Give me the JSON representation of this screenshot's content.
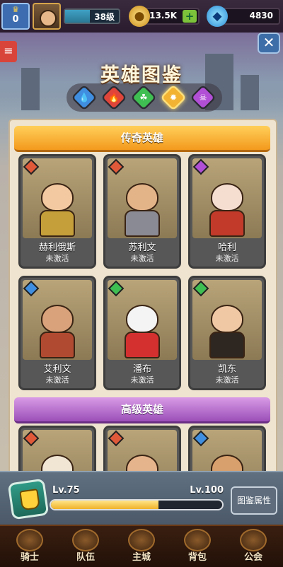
{
  "hud": {
    "rank_value": "0",
    "level_label": "38级",
    "coins": "13.5K",
    "gems": "4830",
    "plus_symbol": "+"
  },
  "panel": {
    "title": "英雄图鉴",
    "close_symbol": "✕",
    "filters": [
      {
        "icon": "water-element-icon",
        "symbol": "💧",
        "color": "#3f8ee0"
      },
      {
        "icon": "fire-element-icon",
        "symbol": "🔥",
        "color": "#e0453a"
      },
      {
        "icon": "nature-element-icon",
        "symbol": "☘",
        "color": "#3fbf52"
      },
      {
        "icon": "light-element-icon",
        "symbol": "✹",
        "color": "#f2b332"
      },
      {
        "icon": "dark-element-icon",
        "symbol": "☠",
        "color": "#b14fd6"
      }
    ],
    "active_filter_index": 3
  },
  "sections": [
    {
      "title": "传奇英雄",
      "heroes": [
        {
          "name": "赫利俄斯",
          "state": "未激活",
          "element_color": "#e05a3a",
          "skin": "#f2c9a0",
          "outfit": "#c5a03a"
        },
        {
          "name": "苏利文",
          "state": "未激活",
          "element_color": "#e05a3a",
          "skin": "#e4b489",
          "outfit": "#8a8a94"
        },
        {
          "name": "哈利",
          "state": "未激活",
          "element_color": "#b14fd6",
          "skin": "#f5ddd0",
          "outfit": "#c23a2a"
        },
        {
          "name": "艾利文",
          "state": "未激活",
          "element_color": "#3f8ee0",
          "skin": "#d9a27a",
          "outfit": "#b04a30"
        },
        {
          "name": "潘布",
          "state": "未激活",
          "element_color": "#3fbf52",
          "skin": "#f4f4f4",
          "outfit": "#d43030"
        },
        {
          "name": "凯东",
          "state": "未激活",
          "element_color": "#3fbf52",
          "skin": "#f0c8a4",
          "outfit": "#2e2620"
        }
      ]
    },
    {
      "title": "高级英雄",
      "heroes": [
        {
          "name": "",
          "state": "",
          "element_color": "#e05a3a",
          "skin": "#f1e6d4",
          "outfit": "#b77c3a"
        },
        {
          "name": "",
          "state": "",
          "element_color": "#e05a3a",
          "skin": "#e6b48c",
          "outfit": "#5a5a6a"
        },
        {
          "name": "",
          "state": "",
          "element_color": "#3f8ee0",
          "skin": "#d8a06c",
          "outfit": "#4a3320"
        }
      ]
    }
  ],
  "collection": {
    "current_level": "Lv.75",
    "max_level": "Lv.100",
    "progress": 0.63,
    "attr_button": "图鉴属性"
  },
  "nav": [
    {
      "label": "骑士",
      "icon": "knight-icon"
    },
    {
      "label": "队伍",
      "icon": "team-icon"
    },
    {
      "label": "主城",
      "icon": "castle-icon"
    },
    {
      "label": "背包",
      "icon": "backpack-icon"
    },
    {
      "label": "公会",
      "icon": "guild-icon"
    }
  ]
}
